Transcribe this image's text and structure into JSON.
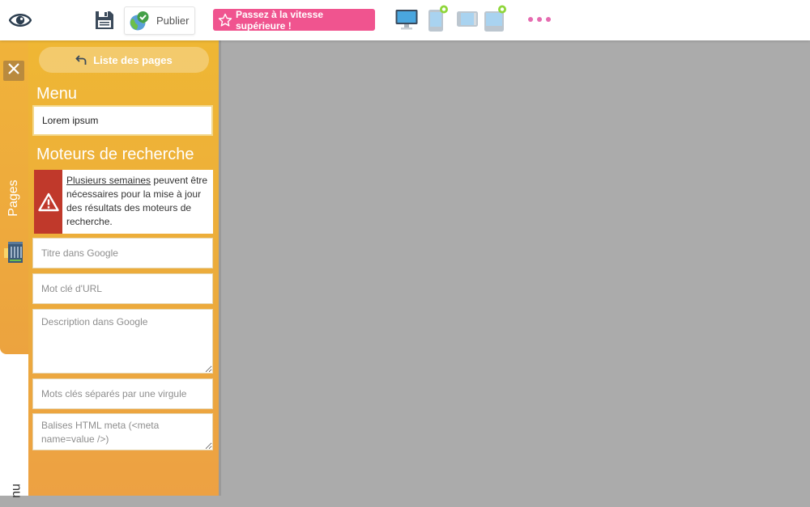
{
  "toolbar": {
    "publish_label": "Publier",
    "upgrade_label": "Passez à la vitesse supérieure !",
    "icons": {
      "preview": "eye-icon",
      "save": "floppy-disk-icon",
      "publish": "globe-check-icon",
      "upgrade": "star-icon",
      "devices": [
        "desktop-icon",
        "phone-icon",
        "tablet-icon",
        "tablet-landscape-icon"
      ],
      "more": "more-dots-icon"
    },
    "colors": {
      "upgrade_bg": "#f0548f",
      "device_active_dot": "#8fd63a",
      "more_dots": "#e56bb0"
    }
  },
  "tabs": {
    "pages_label": "Pages",
    "menu_label": "nu"
  },
  "panel": {
    "back_label": "Liste des pages",
    "menu_heading": "Menu",
    "menu_value": "Lorem ipsum",
    "seo_heading": "Moteurs de recherche",
    "warning": {
      "link_text": "Plusieurs semaines",
      "rest_text": " peuvent être nécessaires pour la mise à jour des résultats des moteurs de recherche."
    },
    "fields": {
      "title_placeholder": "Titre dans Google",
      "slug_placeholder": "Mot clé d'URL",
      "description_placeholder": "Description dans Google",
      "keywords_placeholder": "Mots clés séparés par une virgule",
      "meta_placeholder": "Balises HTML meta (<meta name=value />)"
    },
    "colors": {
      "panel": "#efb734",
      "warning": "#c0392b"
    }
  }
}
